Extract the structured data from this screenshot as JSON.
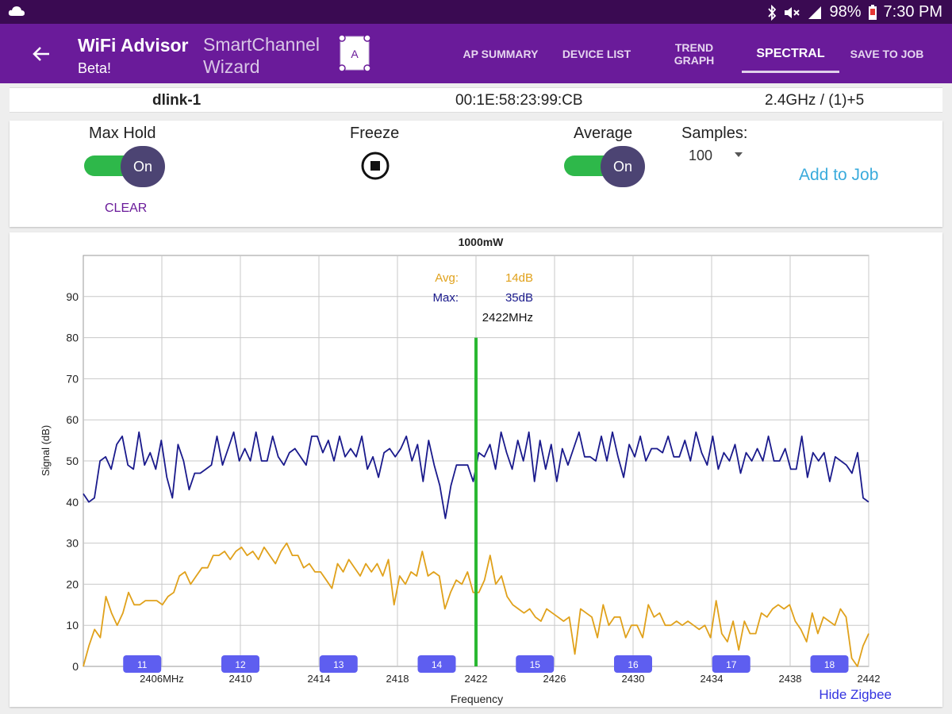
{
  "statusbar": {
    "battery": "98%",
    "time": "7:30 PM",
    "icons": [
      "cloud-icon",
      "bluetooth-icon",
      "mute-icon",
      "signal-icon",
      "battery-icon"
    ]
  },
  "appbar": {
    "title": "WiFi Advisor",
    "subtitle": "Beta!",
    "wizard_line1": "SmartChannel",
    "wizard_line2": "Wizard",
    "wizard_icon_letter": "A",
    "tabs": [
      {
        "line1": "AP SUMMARY",
        "line2": "",
        "active": false
      },
      {
        "line1": "DEVICE LIST",
        "line2": "",
        "active": false
      },
      {
        "line1": "TREND",
        "line2": "GRAPH",
        "active": false
      },
      {
        "line1": "SPECTRAL",
        "line2": "",
        "active": true
      },
      {
        "line1": "SAVE TO JOB",
        "line2": "",
        "active": false
      }
    ],
    "colors": {
      "statusbar": "#3a0a52",
      "appbar": "#6a1b9a"
    }
  },
  "info": {
    "ssid": "dlink-1",
    "mac": "00:1E:58:23:99:CB",
    "band": "2.4GHz / (1)+5"
  },
  "controls": {
    "max_hold_label": "Max Hold",
    "max_hold_state": "On",
    "clear_label": "CLEAR",
    "freeze_label": "Freeze",
    "average_label": "Average",
    "average_state": "On",
    "samples_label": "Samples:",
    "samples_value": "100",
    "add_to_job": "Add to Job"
  },
  "chart_data": {
    "type": "line",
    "title": "1000mW",
    "xlabel": "Frequency",
    "ylabel": "Signal (dB)",
    "xlim": [
      2402,
      2442
    ],
    "ylim": [
      0,
      100
    ],
    "x_tick_labels": [
      "2406MHz",
      "2410",
      "2414",
      "2418",
      "2422",
      "2426",
      "2430",
      "2434",
      "2438",
      "2442"
    ],
    "x_tick_values": [
      2406,
      2410,
      2414,
      2418,
      2422,
      2426,
      2430,
      2434,
      2438,
      2442
    ],
    "y_ticks": [
      0,
      10,
      20,
      30,
      40,
      50,
      60,
      70,
      80,
      90
    ],
    "grid": true,
    "series": [
      {
        "color": "#1a1a8c",
        "values": [
          42,
          40,
          41,
          50,
          51,
          48,
          54,
          56,
          49,
          48,
          57,
          49,
          52,
          48,
          55,
          46,
          41,
          54,
          50,
          43,
          47,
          47,
          48,
          49,
          56,
          49,
          53,
          57,
          50,
          53,
          50,
          57,
          50,
          50,
          56,
          51,
          49,
          52,
          53,
          51,
          49,
          56,
          56,
          52,
          55,
          50,
          56,
          51,
          53,
          51,
          56,
          48,
          51,
          46,
          52,
          53,
          51,
          53,
          56,
          50,
          54,
          45,
          55,
          49,
          44,
          36,
          44,
          49,
          49,
          49,
          45,
          52,
          51,
          54,
          48,
          57,
          52,
          48,
          55,
          50,
          57,
          45,
          55,
          48,
          54,
          45,
          53,
          49,
          53,
          57,
          51,
          51,
          50,
          56,
          50,
          57,
          51,
          46,
          54,
          51,
          56,
          50,
          53,
          53,
          52,
          56,
          51,
          51,
          55,
          50,
          57,
          52,
          49,
          56,
          48,
          52,
          50,
          54,
          47,
          52,
          50,
          53,
          50,
          56,
          50,
          50,
          53,
          48,
          48,
          56,
          46,
          52,
          50,
          52,
          45,
          51,
          50,
          49,
          47,
          52,
          41,
          40
        ]
      },
      {
        "color": "#e0a11b",
        "values": [
          0,
          5,
          9,
          7,
          17,
          13,
          10,
          13,
          18,
          15,
          15,
          16,
          16,
          16,
          15,
          17,
          18,
          22,
          23,
          20,
          22,
          24,
          24,
          27,
          27,
          28,
          26,
          28,
          29,
          27,
          28,
          26,
          29,
          27,
          25,
          28,
          30,
          27,
          27,
          24,
          25,
          23,
          23,
          21,
          19,
          25,
          23,
          26,
          24,
          22,
          25,
          23,
          25,
          22,
          26,
          15,
          22,
          20,
          23,
          22,
          28,
          22,
          23,
          22,
          14,
          18,
          21,
          20,
          23,
          18,
          18,
          21,
          27,
          20,
          22,
          17,
          15,
          14,
          13,
          14,
          12,
          11,
          14,
          13,
          12,
          11,
          12,
          3,
          14,
          13,
          12,
          7,
          15,
          10,
          12,
          12,
          7,
          10,
          10,
          7,
          15,
          12,
          13,
          10,
          10,
          11,
          10,
          11,
          10,
          9,
          10,
          7,
          16,
          8,
          6,
          11,
          4,
          11,
          8,
          8,
          13,
          12,
          14,
          15,
          14,
          15,
          11,
          9,
          6,
          13,
          8,
          12,
          11,
          10,
          14,
          12,
          2,
          0,
          5,
          8
        ]
      }
    ],
    "annotation": {
      "avg_label": "Avg:",
      "avg_value": "14dB",
      "max_label": "Max:",
      "max_value": "35dB",
      "freq": "2422MHz",
      "marker_x": 2422,
      "marker_top": 80,
      "marker_color": "#2ab832"
    },
    "channel_labels": [
      {
        "label": "11",
        "x": 2405
      },
      {
        "label": "12",
        "x": 2410
      },
      {
        "label": "13",
        "x": 2415
      },
      {
        "label": "14",
        "x": 2420
      },
      {
        "label": "15",
        "x": 2425
      },
      {
        "label": "16",
        "x": 2430
      },
      {
        "label": "17",
        "x": 2435
      },
      {
        "label": "18",
        "x": 2440
      }
    ],
    "channel_color": "#5e5ef0",
    "hide_zigbee": "Hide Zigbee"
  }
}
